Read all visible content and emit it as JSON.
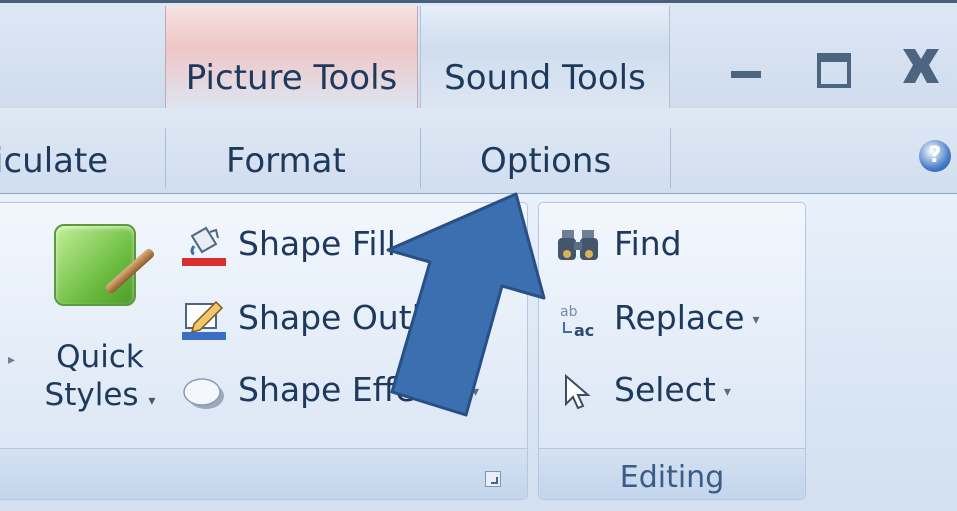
{
  "context_tabs": {
    "picture_tools": "Picture Tools",
    "sound_tools": "Sound Tools"
  },
  "tabs": [
    {
      "label": "iculate"
    },
    {
      "label": "Format"
    },
    {
      "label": "Options"
    }
  ],
  "ribbon": {
    "drawing": {
      "quick_styles": {
        "line1": "Quick",
        "line2": "Styles",
        "arrow": "▾"
      },
      "shape_fill": "Shape Fill",
      "shape_outline": "Shape Outli",
      "shape_effects": "Shape Effects",
      "shape_effects_arrow": "▾"
    },
    "editing": {
      "label": "Editing",
      "find": "Find",
      "replace": "Replace",
      "replace_arrow": "▾",
      "select": "Select",
      "select_arrow": "▾"
    }
  },
  "help": {
    "glyph": "?"
  },
  "overlay": {
    "annotation_arrow_color": "#3b6fb0"
  }
}
